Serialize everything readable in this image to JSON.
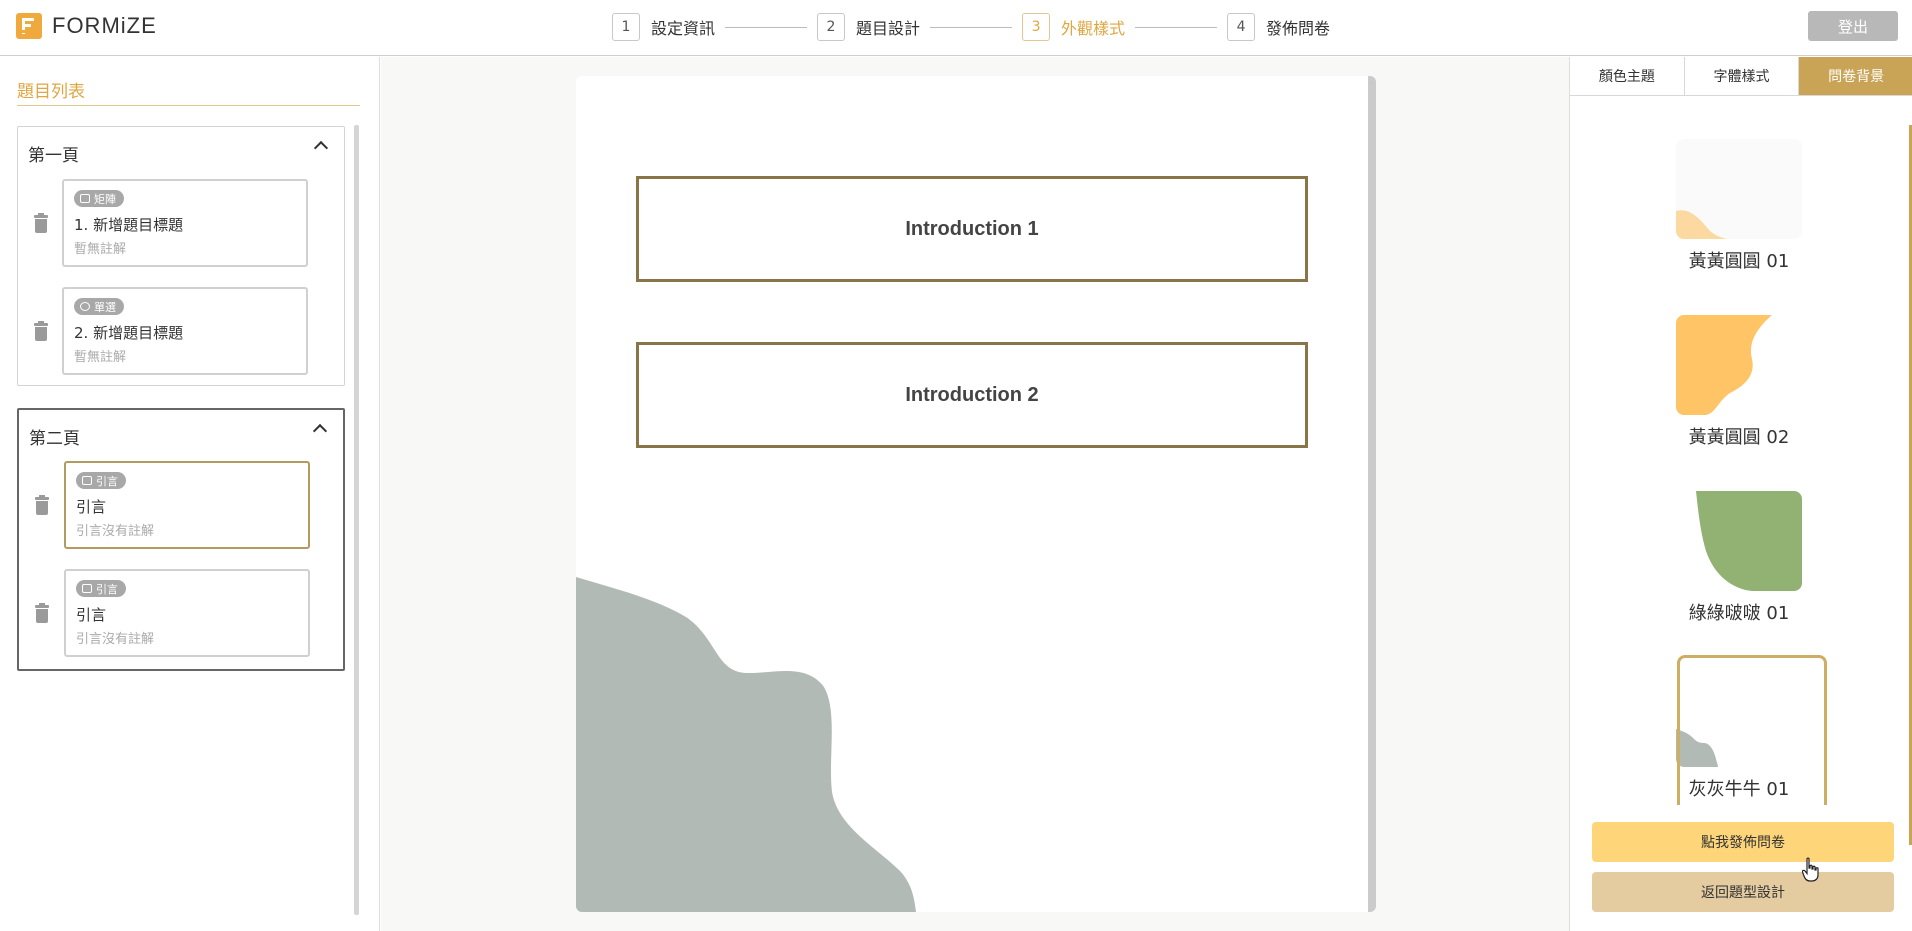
{
  "app": {
    "logo_text": "FORMiZE"
  },
  "steps": [
    {
      "num": "1",
      "label": "設定資訊"
    },
    {
      "num": "2",
      "label": "題目設計"
    },
    {
      "num": "3",
      "label": "外觀樣式"
    },
    {
      "num": "4",
      "label": "發佈問卷"
    }
  ],
  "active_step": "3",
  "header": {
    "logout_label": "登出"
  },
  "sidebar": {
    "title": "題目列表",
    "pages": [
      {
        "title": "第一頁",
        "questions": [
          {
            "badge": "矩陣",
            "badge_icon": "matrix-icon",
            "title": "1. 新增題目標題",
            "note": "暫無註解"
          },
          {
            "badge": "單選",
            "badge_icon": "radio-check-icon",
            "title": "2. 新增題目標題",
            "note": "暫無註解"
          }
        ]
      },
      {
        "title": "第二頁",
        "questions": [
          {
            "badge": "引言",
            "badge_icon": "quote-icon",
            "title": "引言",
            "note": "引言沒有註解"
          },
          {
            "badge": "引言",
            "badge_icon": "quote-icon",
            "title": "引言",
            "note": "引言沒有註解"
          }
        ]
      }
    ]
  },
  "preview": {
    "intros": [
      "Introduction 1",
      "Introduction 2"
    ],
    "background_color": "#b2bab5"
  },
  "right_panel": {
    "tabs": [
      {
        "label": "顏色主題"
      },
      {
        "label": "字體樣式"
      },
      {
        "label": "問卷背景"
      }
    ],
    "active_tab": "問卷背景",
    "backgrounds": [
      {
        "label": "黃黃圓圓 01",
        "color": "#fcd9a0"
      },
      {
        "label": "黃黃圓圓 02",
        "color": "#fec466"
      },
      {
        "label": "綠綠啵啵 01",
        "color": "#91b272"
      },
      {
        "label": "灰灰牛牛 01",
        "color": "#b2bab5"
      }
    ],
    "selected_background": "灰灰牛牛 01",
    "publish_label": "點我發佈問卷",
    "back_label": "返回題型設計"
  },
  "colors": {
    "accent": "#e0a642",
    "tab_active": "#c9a456",
    "publish": "#ffd57a",
    "back": "#e4cca0"
  }
}
